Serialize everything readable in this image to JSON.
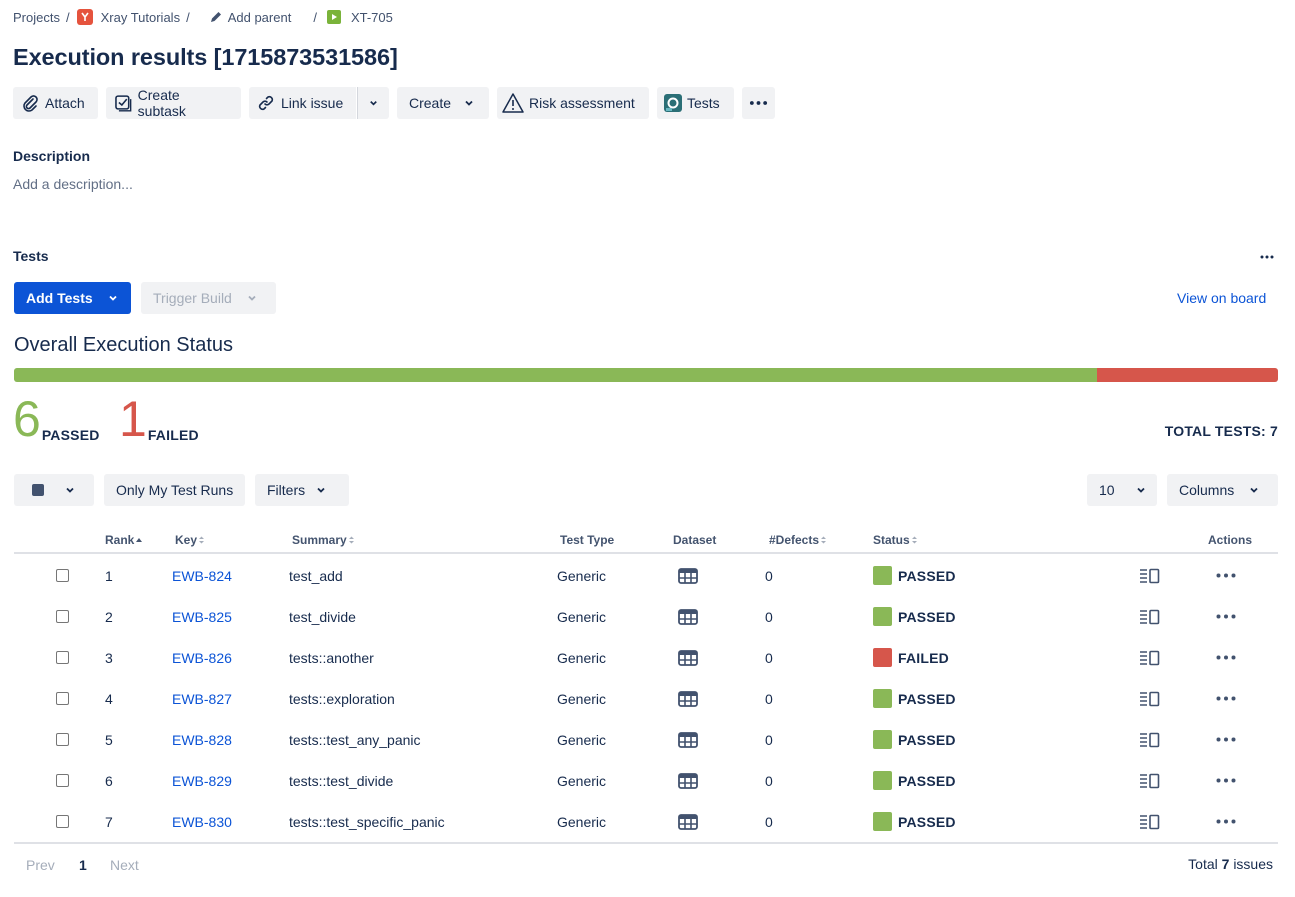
{
  "breadcrumb": {
    "projects": "Projects",
    "project": "Xray Tutorials",
    "add_parent": "Add parent",
    "issue_key": "XT-705"
  },
  "title": "Execution results [1715873531586]",
  "toolbar": {
    "attach": "Attach",
    "create_subtask": "Create subtask",
    "link_issue": "Link issue",
    "create": "Create",
    "risk_assessment": "Risk assessment",
    "tests": "Tests"
  },
  "description": {
    "label": "Description",
    "placeholder": "Add a description..."
  },
  "tests_section": {
    "label": "Tests",
    "add_tests": "Add Tests",
    "trigger_build": "Trigger Build",
    "view_on_board": "View on board"
  },
  "overall": {
    "title": "Overall Execution Status",
    "passed_count": "6",
    "passed_label": "PASSED",
    "failed_count": "1",
    "failed_label": "FAILED",
    "total_label": "TOTAL TESTS: 7",
    "passed_fraction": 0.857,
    "failed_fraction": 0.143
  },
  "filters": {
    "only_mine": "Only My Test Runs",
    "filters": "Filters",
    "page_size": "10",
    "columns": "Columns"
  },
  "table": {
    "headers": {
      "rank": "Rank",
      "key": "Key",
      "summary": "Summary",
      "test_type": "Test Type",
      "dataset": "Dataset",
      "defects": "#Defects",
      "status": "Status",
      "actions": "Actions"
    },
    "rows": [
      {
        "rank": "1",
        "key": "EWB-824",
        "summary": "test_add",
        "type": "Generic",
        "defects": "0",
        "status": "PASSED"
      },
      {
        "rank": "2",
        "key": "EWB-825",
        "summary": "test_divide",
        "type": "Generic",
        "defects": "0",
        "status": "PASSED"
      },
      {
        "rank": "3",
        "key": "EWB-826",
        "summary": "tests::another",
        "type": "Generic",
        "defects": "0",
        "status": "FAILED"
      },
      {
        "rank": "4",
        "key": "EWB-827",
        "summary": "tests::exploration",
        "type": "Generic",
        "defects": "0",
        "status": "PASSED"
      },
      {
        "rank": "5",
        "key": "EWB-828",
        "summary": "tests::test_any_panic",
        "type": "Generic",
        "defects": "0",
        "status": "PASSED"
      },
      {
        "rank": "6",
        "key": "EWB-829",
        "summary": "tests::test_divide",
        "type": "Generic",
        "defects": "0",
        "status": "PASSED"
      },
      {
        "rank": "7",
        "key": "EWB-830",
        "summary": "tests::test_specific_panic",
        "type": "Generic",
        "defects": "0",
        "status": "PASSED"
      }
    ]
  },
  "pagination": {
    "prev": "Prev",
    "current": "1",
    "next": "Next",
    "total_prefix": "Total",
    "total_count": "7",
    "total_suffix": "issues"
  },
  "colors": {
    "passed": "#8ab857",
    "failed": "#d6564b",
    "link": "#0c54d6",
    "primary": "#0c54d6"
  },
  "icons": [
    "paperclip-icon",
    "subtask-icon",
    "link-icon",
    "chevron-down-icon",
    "warning-icon",
    "xray-tests-icon",
    "more-icon",
    "dataset-grid-icon",
    "details-icon"
  ]
}
